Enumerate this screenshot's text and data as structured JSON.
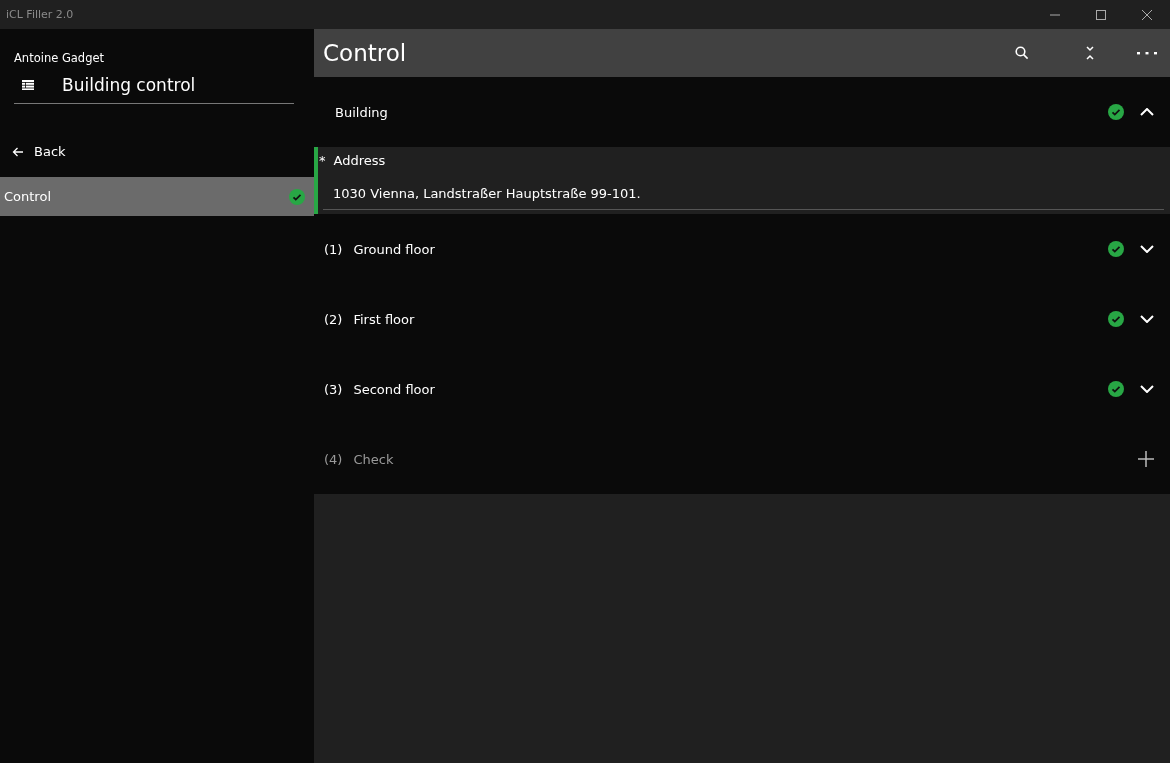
{
  "window": {
    "title": "iCL Filler 2.0"
  },
  "sidebar": {
    "user": "Antoine Gadget",
    "project": "Building control",
    "back": "Back",
    "items": [
      {
        "label": "Control",
        "selected": true,
        "done": true
      }
    ]
  },
  "header": {
    "title": "Control"
  },
  "sections": [
    {
      "kind": "group",
      "label": "Building",
      "done": true,
      "expanded": true,
      "fields": [
        {
          "label": "Address",
          "required": true,
          "required_mark": "*",
          "value": "1030 Vienna, Landstraßer Hauptstraße 99-101."
        }
      ]
    },
    {
      "kind": "group",
      "number": "(1)",
      "label": "Ground floor",
      "done": true,
      "expanded": false
    },
    {
      "kind": "group",
      "number": "(2)",
      "label": "First floor",
      "done": true,
      "expanded": false
    },
    {
      "kind": "group",
      "number": "(3)",
      "label": "Second floor",
      "done": true,
      "expanded": false
    },
    {
      "kind": "add",
      "number": "(4)",
      "label": "Check",
      "disabled": true
    }
  ]
}
